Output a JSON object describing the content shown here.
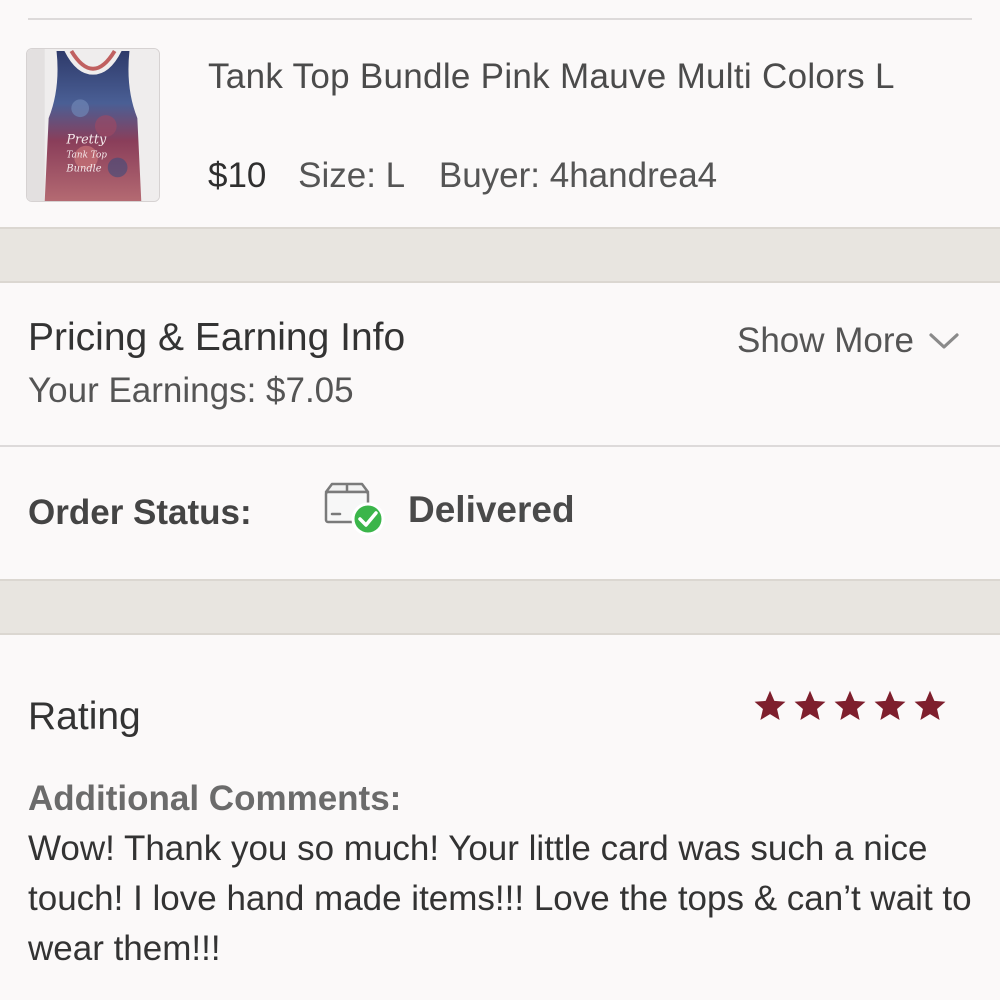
{
  "product": {
    "title": "Tank Top Bundle Pink Mauve Multi Colors L",
    "price": "$10",
    "size": "Size: L",
    "buyer": "Buyer: 4handrea4",
    "thumbnail_caption": "Pretty Tank Top Bundle"
  },
  "pricing": {
    "title": "Pricing & Earning Info",
    "earnings": "Your Earnings: $7.05",
    "show_more": "Show More"
  },
  "order": {
    "label": "Order Status:",
    "status": "Delivered",
    "status_icon": "delivered-box-check-icon",
    "status_color": "#3bb54a"
  },
  "rating": {
    "title": "Rating",
    "stars": 5,
    "star_color": "#7e1f2d",
    "comments_label": "Additional Comments:",
    "comments": "Wow! Thank you so much! Your little card was such a nice touch! I love hand made items!!! Love the tops & can’t wait to wear them!!!"
  }
}
